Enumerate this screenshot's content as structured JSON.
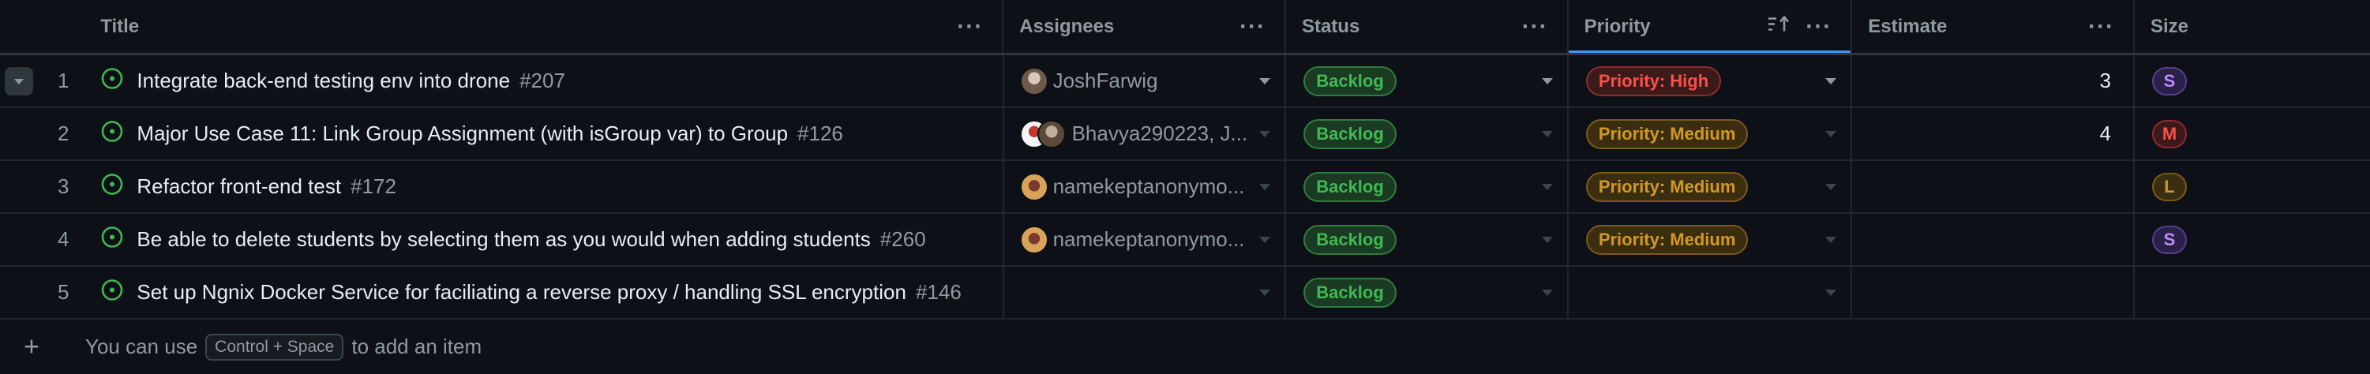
{
  "columns": {
    "title": "Title",
    "assignees": "Assignees",
    "status": "Status",
    "priority": "Priority",
    "estimate": "Estimate",
    "size": "Size"
  },
  "rows": [
    {
      "index": "1",
      "title": "Integrate back-end testing env into drone",
      "number": "#207",
      "assignees": "JoshFarwig",
      "status": "Backlog",
      "priority": "Priority: High",
      "estimate": "3",
      "size": "S"
    },
    {
      "index": "2",
      "title": "Major Use Case 11: Link Group Assignment (with isGroup var) to Group",
      "number": "#126",
      "assignees": "Bhavya290223, J...",
      "status": "Backlog",
      "priority": "Priority: Medium",
      "estimate": "4",
      "size": "M"
    },
    {
      "index": "3",
      "title": "Refactor front-end test",
      "number": "#172",
      "assignees": "namekeptanonymo...",
      "status": "Backlog",
      "priority": "Priority: Medium",
      "estimate": "",
      "size": "L"
    },
    {
      "index": "4",
      "title": "Be able to delete students by selecting them as you would when adding students",
      "number": "#260",
      "assignees": "namekeptanonymo...",
      "status": "Backlog",
      "priority": "Priority: Medium",
      "estimate": "",
      "size": "S"
    },
    {
      "index": "5",
      "title": "Set up Ngnix Docker Service for faciliating a reverse proxy / handling SSL encryption",
      "number": "#146",
      "assignees": "",
      "status": "Backlog",
      "priority": "",
      "estimate": "",
      "size": ""
    }
  ],
  "add_item": {
    "prefix": "You can use",
    "shortcut": "Control + Space",
    "suffix": "to add an item"
  },
  "colors": {
    "background": "#0d1117",
    "backlog": "#3fb950",
    "priority_high": "#f85149",
    "priority_medium": "#d29922",
    "size_s": "#bc8cff",
    "size_m": "#f85149",
    "size_l": "#d29922",
    "open_issue": "#3fb950"
  },
  "icons": {
    "issue": "issue-open-icon",
    "more": "kebab-menu-icon",
    "sort": "sort-ascending-icon",
    "add": "plus-icon",
    "expand": "chevron-down-icon",
    "dropdown": "caret-down-icon"
  }
}
